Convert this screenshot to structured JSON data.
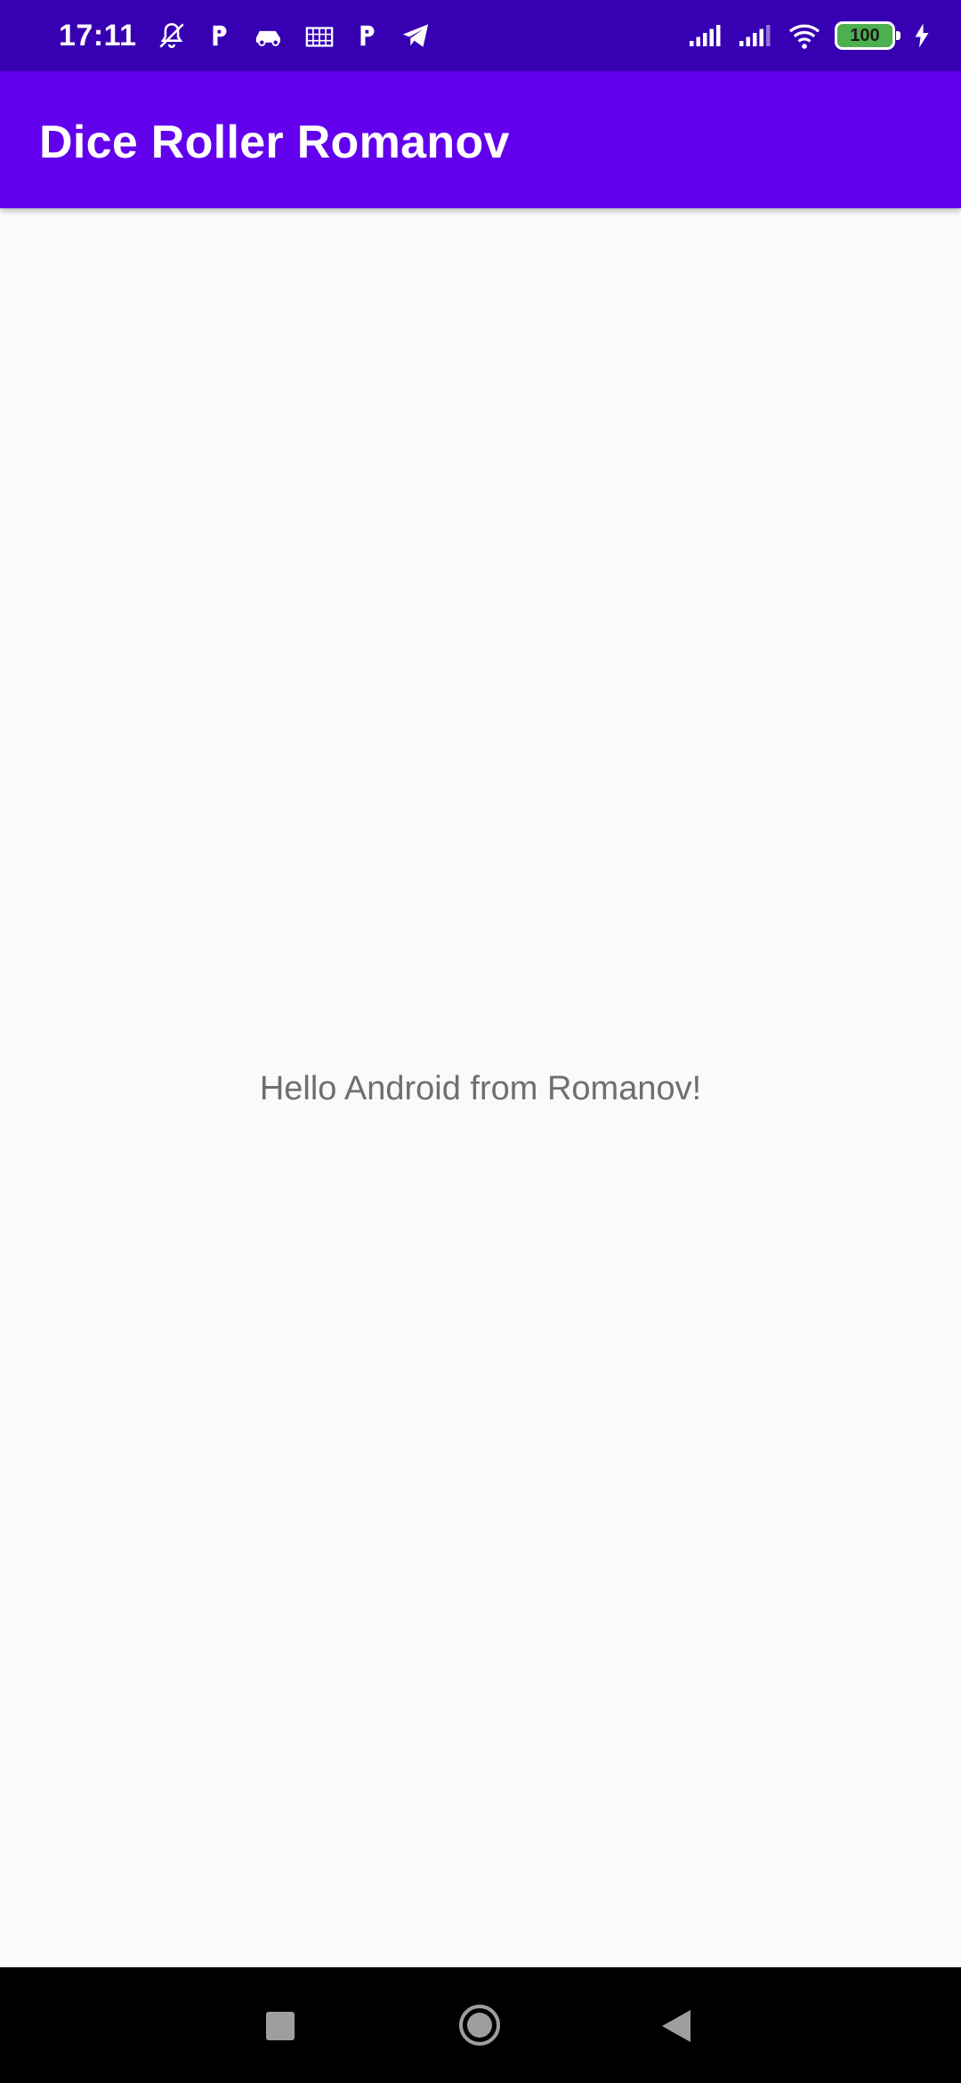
{
  "status_bar": {
    "time": "17:11",
    "battery_level": "100",
    "icons_left": [
      "bell-off-icon",
      "p-icon",
      "car-icon",
      "grid-icon",
      "p-icon",
      "telegram-icon"
    ],
    "icons_right": [
      "signal-icon",
      "signal-icon",
      "wifi-icon",
      "battery-icon",
      "charging-icon"
    ]
  },
  "app_bar": {
    "title": "Dice Roller Romanov"
  },
  "main": {
    "message": "Hello Android from Romanov!"
  },
  "nav_bar": {
    "buttons": [
      "recent-apps",
      "home",
      "back"
    ]
  },
  "colors": {
    "status_bar": "#3700b3",
    "app_bar": "#6200ee",
    "background": "#fafafa",
    "message_text": "#6f6f6f",
    "battery": "#4caf50"
  }
}
